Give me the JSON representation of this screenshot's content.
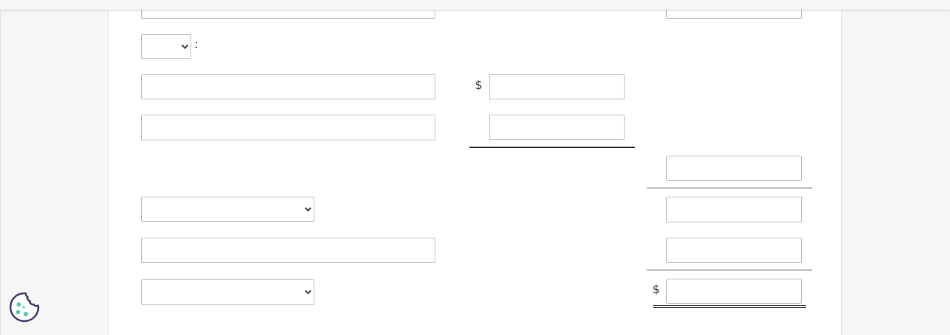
{
  "form": {
    "top_row": {
      "desc_value": "",
      "amount_value": ""
    },
    "period_select": {
      "selected": "",
      "colon": ":"
    },
    "row1": {
      "desc_value": "",
      "currency": "$",
      "amount_value": ""
    },
    "row2": {
      "desc_value": "",
      "amount_value": ""
    },
    "subtotal": {
      "amount_value": ""
    },
    "row3_select": {
      "selected": ""
    },
    "row3": {
      "amount_value": ""
    },
    "row4": {
      "desc_value": "",
      "amount_value": ""
    },
    "total_select": {
      "selected": ""
    },
    "total": {
      "currency": "$",
      "amount_value": ""
    }
  },
  "colors": {
    "page_bg": "#f5f5f5",
    "panel_bg": "#ffffff",
    "input_border": "#b8b8b8",
    "rule": "#333333",
    "cookie_stroke": "#3b3565",
    "cookie_dots": "#4dd0a7"
  },
  "icons": {
    "cookie": "cookie-settings-icon"
  }
}
